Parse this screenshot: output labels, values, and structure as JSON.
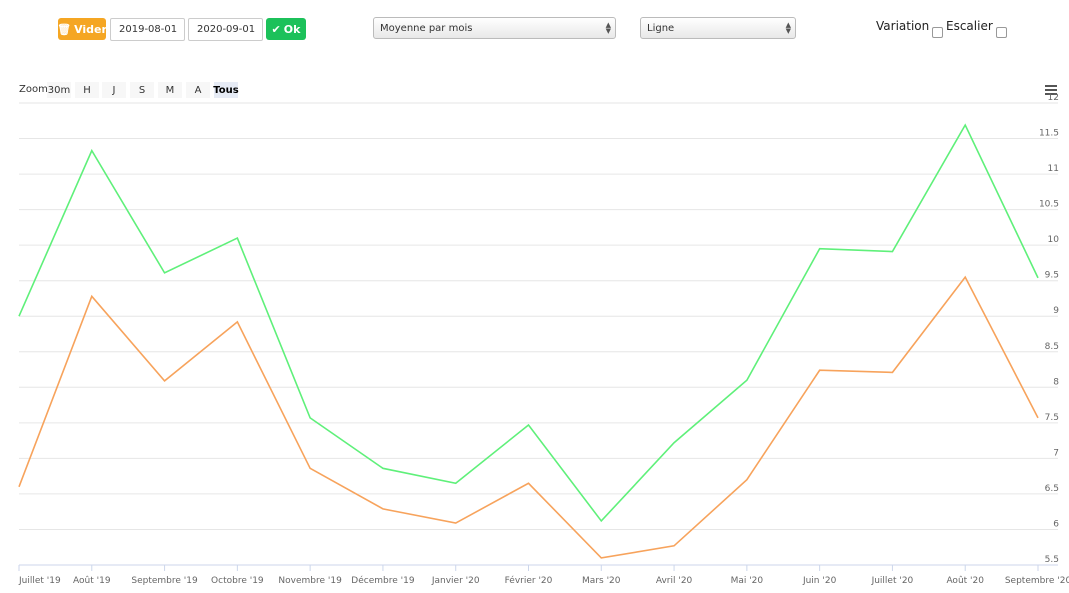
{
  "toolbar": {
    "clear_label": "Vider",
    "start_date": "2019-08-01",
    "end_date": "2020-09-01",
    "ok_label": "Ok",
    "aggregation": "Moyenne par mois",
    "chart_type": "Ligne",
    "variation_label": "Variation",
    "staircase_label": "Escalier",
    "variation_checked": false,
    "staircase_checked": false
  },
  "zoom": {
    "label": "Zoom",
    "buttons": [
      "30m",
      "H",
      "J",
      "S",
      "M",
      "A",
      "Tous"
    ],
    "active": "Tous"
  },
  "colors": {
    "orange": "#f7a35c",
    "green": "#5ff07a",
    "clear": "#f5a623",
    "ok": "#1cc15a"
  },
  "chart_data": {
    "type": "line",
    "categories": [
      "Juillet '19",
      "Août '19",
      "Septembre '19",
      "Octobre '19",
      "Novembre '19",
      "Décembre '19",
      "Janvier '20",
      "Février '20",
      "Mars '20",
      "Avril '20",
      "Mai '20",
      "Juin '20",
      "Juillet '20",
      "Août '20",
      "Septembre '20"
    ],
    "series": [
      {
        "name": "green",
        "color": "#5ff07a",
        "values": [
          9.0,
          11.33,
          9.61,
          10.1,
          7.57,
          6.86,
          6.65,
          7.47,
          6.12,
          7.22,
          8.1,
          9.95,
          9.91,
          11.69,
          9.54
        ]
      },
      {
        "name": "orange",
        "color": "#f7a35c",
        "values": [
          6.6,
          9.28,
          8.09,
          8.92,
          6.86,
          6.29,
          6.09,
          6.65,
          5.6,
          5.77,
          6.7,
          8.24,
          8.21,
          9.55,
          7.57
        ]
      }
    ],
    "yticks": [
      "5.5",
      "6",
      "6.5",
      "7",
      "7.5",
      "8",
      "8.5",
      "9",
      "9.5",
      "10",
      "10.5",
      "11",
      "11.5",
      "12"
    ],
    "ylim": [
      5.5,
      12
    ],
    "grid": true,
    "axis_side": "right"
  }
}
